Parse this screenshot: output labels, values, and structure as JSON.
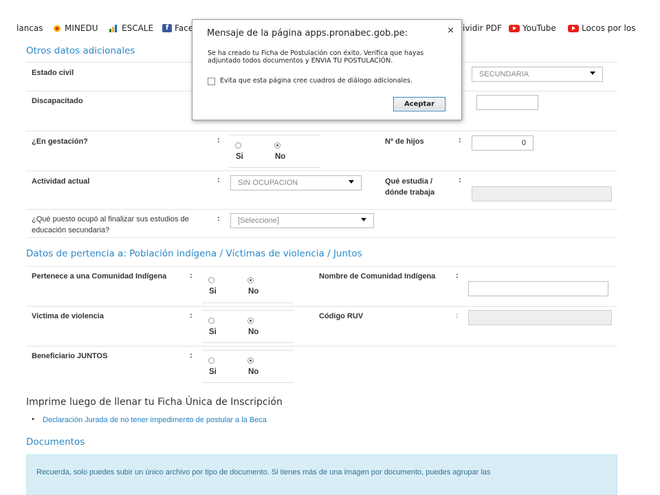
{
  "bookmarks": {
    "items": [
      {
        "label": "lancas"
      },
      {
        "label": "MINEDU"
      },
      {
        "label": "ESCALE"
      },
      {
        "label": "Face"
      },
      {
        "label": "ividir PDF"
      },
      {
        "label": "YouTube"
      },
      {
        "label": "Locos por los"
      }
    ]
  },
  "section_otros": {
    "title": "Otros datos adicionales"
  },
  "fields": {
    "estado_civil": {
      "label": "Estado civil"
    },
    "nivel_select": {
      "value": "SECUNDARIA"
    },
    "discapacitado": {
      "label": "Discapacitado"
    },
    "gestacion": {
      "label": "¿En gestación?",
      "colon": ":",
      "yes": "Si",
      "no": "No",
      "selected": "No"
    },
    "hijos": {
      "label": "Nº de hijos",
      "colon": ":",
      "value": "0"
    },
    "actividad": {
      "label": "Actividad actual",
      "colon": ":",
      "value": "SIN OCUPACION"
    },
    "estudia": {
      "label": "Qué estudia / dónde trabaja",
      "colon": ":",
      "value": ""
    },
    "puesto": {
      "label": "¿Qué puesto ocupó al finalizar sus estudios de educación secundaria?",
      "colon": ":",
      "value": "[Seleccione]"
    }
  },
  "section_pertenencia": {
    "title": "Datos de pertencia a: Población indígena / Víctimas de violencia / Juntos"
  },
  "pertenencia": {
    "comunidad": {
      "label": "Pertenece a una Comunidad Indígena",
      "colon": ":",
      "yes": "Si",
      "no": "No",
      "selected": "No"
    },
    "nombre_comunidad": {
      "label": "Nombre de Comunidad Indígena",
      "colon": ":",
      "value": ""
    },
    "violencia": {
      "label": "Victima de violencia",
      "colon": ":",
      "yes": "Si",
      "no": "No",
      "selected": "No"
    },
    "ruv": {
      "label": "Código RUV",
      "colon": ":",
      "value": ""
    },
    "juntos": {
      "label": "Beneficiario JUNTOS",
      "colon": ":",
      "yes": "Si",
      "no": "No",
      "selected": "No"
    }
  },
  "imprime": {
    "title": "Imprime luego de llenar tu Ficha Única de Inscripción",
    "link": "Declaración Jurada de no tener impedimento de postular a la Beca"
  },
  "documentos": {
    "title": "Documentos",
    "info": "Recuerda, solo puedes subir un único archivo por tipo de documento. Si tienes más de una imagen por documento, puedes agrupar las"
  },
  "dialog": {
    "title": "Mensaje de la página apps.pronabec.gob.pe:",
    "close": "×",
    "message": "Se ha creado tu Ficha de Postulación con éxito. Verifica que hayas adjuntado todos documentos y ENVIA TU POSTULACIÓN.",
    "checkbox_label": "Evita que esta página cree cuadros de diálogo adicionales.",
    "accept": "Aceptar"
  },
  "colors": {
    "accent": "#2a88c7",
    "info_bg": "#d9edf7",
    "youtube": "#e62117",
    "facebook": "#3b5998"
  },
  "icons": [
    "minedu-icon",
    "escale-icon",
    "facebook-icon",
    "youtube-icon"
  ]
}
